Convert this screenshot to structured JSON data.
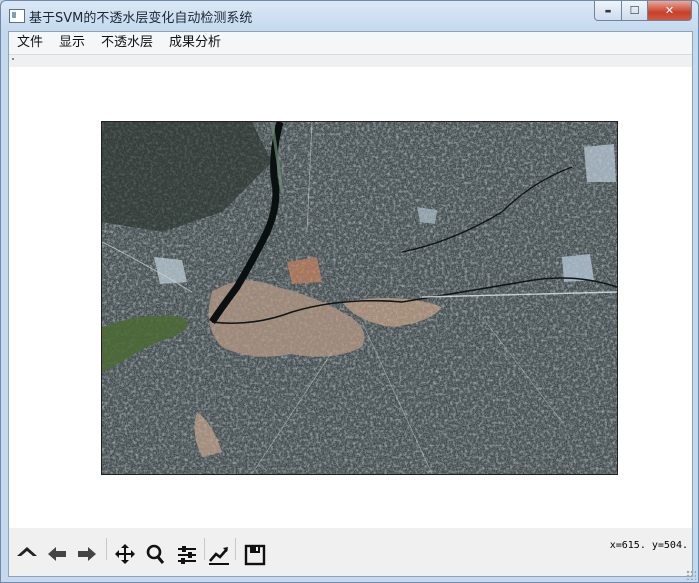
{
  "window": {
    "title": "基于SVM的不透水层变化自动检测系统",
    "controls": {
      "minimize": "▬",
      "maximize": "☐",
      "close": "✕"
    }
  },
  "menu": [
    "文件",
    "显示",
    "不透水层",
    "成果分析"
  ],
  "toolbar": {
    "tools": [
      "home-icon",
      "back-arrow-icon",
      "forward-arrow-icon",
      "pan-icon",
      "zoom-icon",
      "configure-subplots-icon",
      "edit-axis-icon",
      "save-icon"
    ],
    "coords": "x=615. y=504."
  },
  "image": {
    "description_colors": {
      "land": "#3a4448",
      "urban": "#c9a88a",
      "water": "#0d1414",
      "vegetation": "#2f3a2a"
    }
  }
}
